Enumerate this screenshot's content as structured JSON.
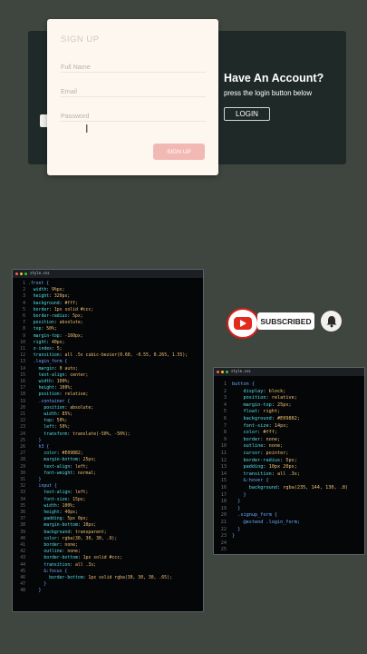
{
  "login_demo": {
    "card_title": "SIGN UP",
    "fields": [
      {
        "placeholder": "Full Name"
      },
      {
        "placeholder": "Email"
      },
      {
        "placeholder": "Password"
      }
    ],
    "signup_label": "SIGN UP",
    "have_account": "Have An Account?",
    "subtitle": "press the login button below",
    "login_label": "LOGIN"
  },
  "youtube": {
    "subscribed_label": "SUBSCRIBED"
  },
  "left_editor": {
    "tab": "style.css",
    "lines": [
      ".front {",
      "  width: 9%px;",
      "  height: 320px;",
      "  background: #fff;",
      "  border: 1px solid #ccc;",
      "  border-radius: 5px;",
      "  position: absolute;",
      "  top: 50%;",
      "  margin-top: -160px;",
      "  right: 40px;",
      "  z-index: 5;",
      "  transition: all .5s cubic-bezier(0.60, -0.55, 0.265, 1.55);",
      "  .login_form {",
      "    margin: 0 auto;",
      "    text-align: center;",
      "    width: 100%;",
      "    height: 100%;",
      "    position: relative;",
      "    .container {",
      "      position: absolute;",
      "      width: 85%;",
      "      top: 50%;",
      "      left: 50%;",
      "      transform: translate(-50%, -50%);",
      "    }",
      "    h3 {",
      "      color: #E09882;",
      "      margin-bottom: 25px;",
      "      text-align: left;",
      "      font-weight: normal;",
      "    }",
      "    input {",
      "      text-align: left;",
      "      font-size: 15px;",
      "      width: 100%;",
      "      height: 40px;",
      "      padding: 5px 0px;",
      "      margin-bottom: 10px;",
      "      background: transparent;",
      "      color: rgba(30, 30, 30, .9);",
      "      border: none;",
      "      outline: none;",
      "      border-bottom: 1px solid #ccc;",
      "      transition: all .3s;",
      "      &:focus {",
      "        border-bottom: 1px solid rgba(30, 30, 30, .65);",
      "      }",
      "    }"
    ]
  },
  "right_editor": {
    "tab": "style.css",
    "lines": [
      "button {",
      "    display: block;",
      "    position: relative;",
      "    margin-top: 25px;",
      "    float: right;",
      "    background: #E09882;",
      "    font-size: 14px;",
      "    color: #fff;",
      "    border: none;",
      "    outline: none;",
      "    cursor: pointer;",
      "    border-radius: 5px;",
      "    padding: 10px 20px;",
      "    transition: all .3s;",
      "    &:hover {",
      "      background: rgba(235, 144, 130, .8)",
      "    }",
      "  }",
      "  }",
      "  .signup_form {",
      "    @extend .login_form;",
      "  }",
      "}",
      "",
      ""
    ]
  },
  "colors": {
    "selector": "#6fa8ff",
    "property": "#4fe0e6",
    "value": "#f0c070",
    "brace": "#d7d7d7",
    "accent": "#E09882"
  }
}
